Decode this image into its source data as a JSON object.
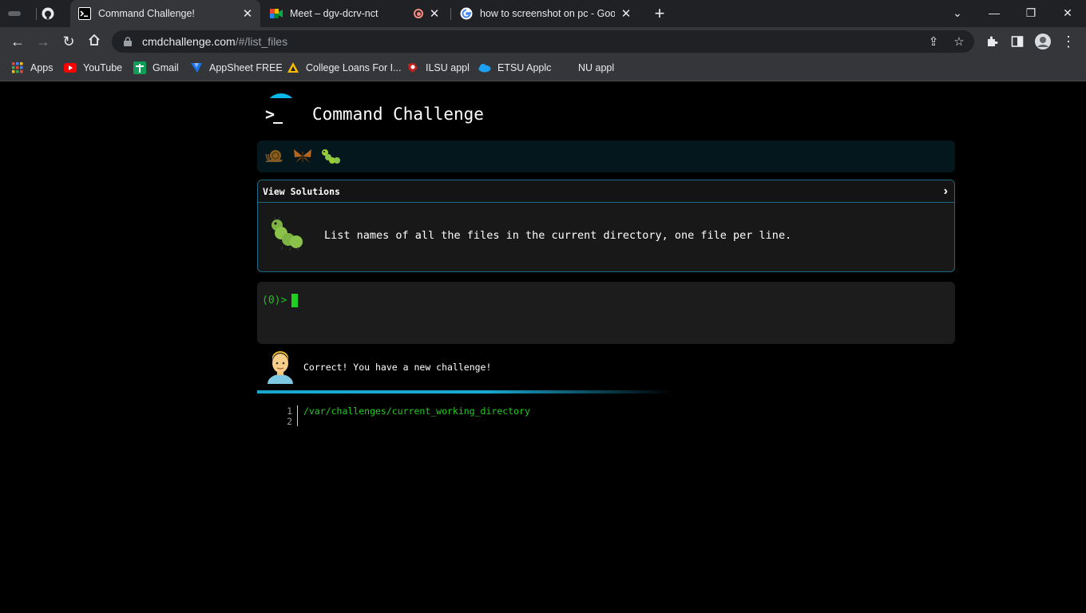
{
  "browser": {
    "tabs": [
      {
        "title": "Command Challenge!",
        "icon": "terminal-favicon-icon",
        "active": true
      },
      {
        "title": "Meet – dgv-dcrv-nct",
        "icon": "google-meet-icon",
        "active": false
      },
      {
        "title": "how to screenshot on pc - Googl",
        "icon": "google-icon",
        "active": false
      }
    ],
    "url_host": "cmdchallenge.com",
    "url_path": "/#/list_files",
    "bookmarks": [
      {
        "label": "Apps",
        "icon": "apps-grid-icon"
      },
      {
        "label": "YouTube",
        "icon": "youtube-icon"
      },
      {
        "label": "Gmail",
        "icon": "gmail-icon"
      },
      {
        "label": "AppSheet FREE",
        "icon": "appsheet-icon"
      },
      {
        "label": "College Loans For I...",
        "icon": "college-loans-icon"
      },
      {
        "label": "ILSU appl",
        "icon": "ilsu-icon"
      },
      {
        "label": "ETSU Applc",
        "icon": "cloud-icon"
      },
      {
        "label": "NU appl",
        "icon": "blank-icon"
      }
    ]
  },
  "page": {
    "site_title": "Command Challenge",
    "logo_glyph": ">_",
    "badges": [
      "snail-icon",
      "butterfly-icon",
      "caterpillar-icon"
    ],
    "view_solutions": "View Solutions",
    "challenge_description": "List names of all the files in the current directory, one file per line.",
    "prompt": "(0)>",
    "correct_message": "Correct! You have a new challenge!",
    "output_lines": [
      {
        "num": "1",
        "text": "/var/challenges/current_working_directory"
      },
      {
        "num": "2",
        "text": ""
      }
    ]
  },
  "colors": {
    "accent": "#0ab7e8",
    "prompt_green": "#20c020",
    "panel_border": "#1f6a83"
  }
}
